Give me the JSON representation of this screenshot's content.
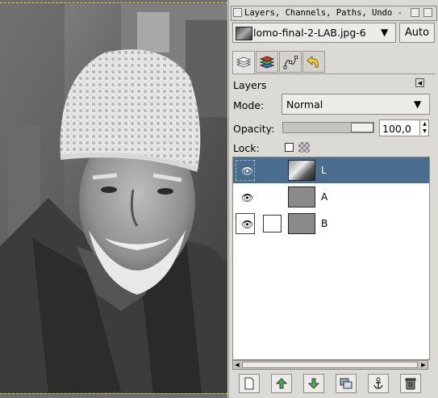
{
  "window": {
    "title": "Layers, Channels, Paths, Undo - B"
  },
  "image_selector": {
    "value": "lomo-final-2-LAB.jpg-6",
    "auto_label": "Auto"
  },
  "tabs": [
    {
      "icon": "layers-icon"
    },
    {
      "icon": "channels-icon"
    },
    {
      "icon": "paths-icon"
    },
    {
      "icon": "undo-icon"
    }
  ],
  "layers_panel": {
    "title": "Layers",
    "mode_label": "Mode:",
    "mode_value": "Normal",
    "opacity_label": "Opacity:",
    "opacity_value": "100,0",
    "opacity_fraction": 1.0,
    "lock_label": "Lock:",
    "layers": [
      {
        "name": "L",
        "selected": true,
        "visible": true
      },
      {
        "name": "A",
        "selected": false,
        "visible": true
      },
      {
        "name": "B",
        "selected": false,
        "visible": true
      }
    ]
  },
  "bottom_buttons": [
    {
      "icon": "new-layer-icon"
    },
    {
      "icon": "raise-layer-icon"
    },
    {
      "icon": "lower-layer-icon"
    },
    {
      "icon": "duplicate-layer-icon"
    },
    {
      "icon": "anchor-layer-icon"
    },
    {
      "icon": "delete-layer-icon"
    }
  ]
}
